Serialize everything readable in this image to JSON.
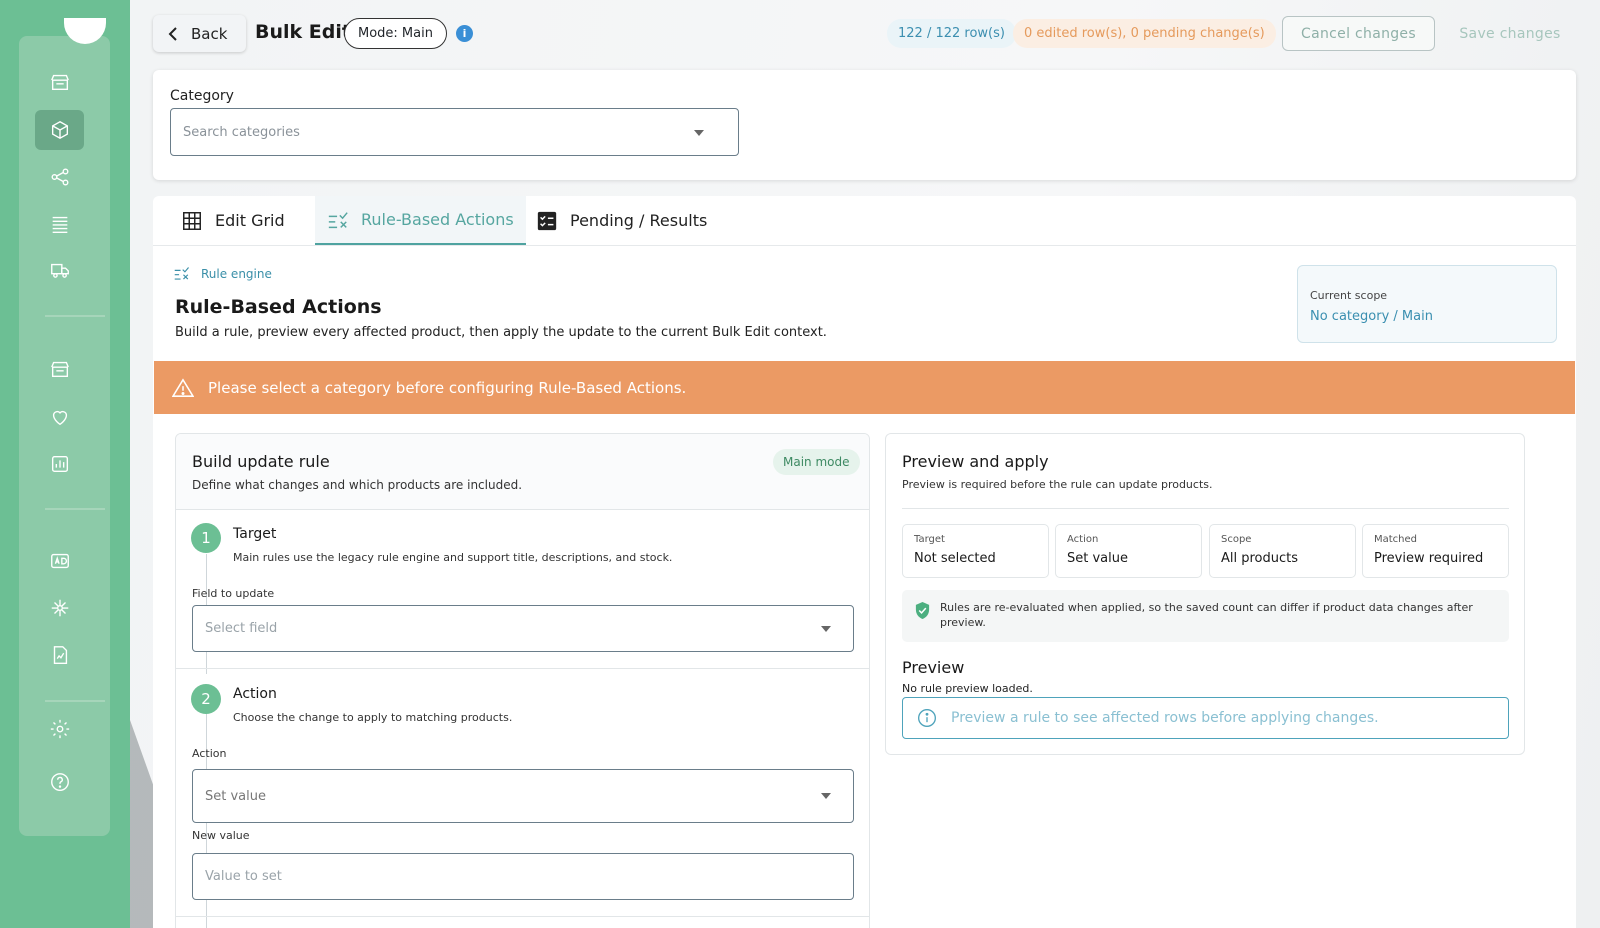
{
  "topbar": {
    "back_label": "Back",
    "title": "Bulk Edit",
    "mode_label": "Mode: Main",
    "info_glyph": "i",
    "rows_count": "122 / 122 row(s)",
    "edited_status": "0 edited row(s), 0 pending change(s)",
    "cancel_label": "Cancel changes",
    "save_label": "Save changes"
  },
  "category": {
    "label": "Category",
    "placeholder": "Search categories"
  },
  "tabs": [
    {
      "label": "Edit Grid",
      "icon": "grid-icon",
      "active": false
    },
    {
      "label": "Rule-Based Actions",
      "icon": "rule-icon",
      "active": true
    },
    {
      "label": "Pending / Results",
      "icon": "checklist-icon",
      "active": false
    }
  ],
  "rules": {
    "engine_label": "Rule engine",
    "title": "Rule-Based Actions",
    "subtitle": "Build a rule, preview every affected product, then apply the update to the current Bulk Edit context.",
    "scope_label": "Current scope",
    "scope_value": "No category / Main",
    "warning": "Please select a category before configuring Rule-Based Actions."
  },
  "build": {
    "title": "Build update rule",
    "subtitle": "Define what changes and which products are included.",
    "mode_badge": "Main mode",
    "step1": {
      "number": "1",
      "title": "Target",
      "desc": "Main rules use the legacy rule engine and support title, descriptions, and stock.",
      "field_label": "Field to update",
      "field_placeholder": "Select field"
    },
    "step2": {
      "number": "2",
      "title": "Action",
      "desc": "Choose the change to apply to matching products.",
      "action_label": "Action",
      "action_value": "Set value",
      "new_value_label": "New value",
      "new_value_placeholder": "Value to set"
    }
  },
  "preview": {
    "title": "Preview and apply",
    "subtitle": "Preview is required before the rule can update products.",
    "stats": [
      {
        "label": "Target",
        "value": "Not selected"
      },
      {
        "label": "Action",
        "value": "Set value"
      },
      {
        "label": "Scope",
        "value": "All products"
      },
      {
        "label": "Matched",
        "value": "Preview required"
      }
    ],
    "note": "Rules are re-evaluated when applied, so the saved count can differ if product data changes after preview.",
    "section_title": "Preview",
    "none_loaded": "No rule preview loaded.",
    "info_text": "Preview a rule to see affected rows before applying changes."
  },
  "colors": {
    "rail": "#6cbf94",
    "accent": "#4fa3a0",
    "warning": "#eb9a64",
    "info": "#3a8fd6"
  }
}
